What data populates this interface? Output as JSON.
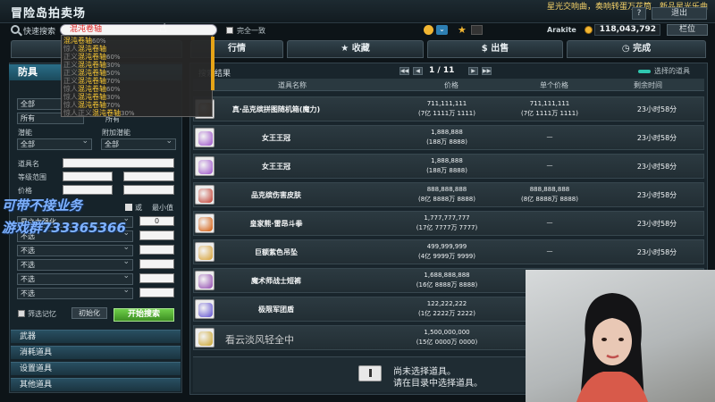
{
  "window": {
    "title": "冒险岛拍卖场",
    "marquee": "星光交响曲，奏响转蛋万花筒，新品星光乐曲",
    "help_btn": "?",
    "exit_btn": "退出"
  },
  "search": {
    "icon": "search-icon",
    "label": "快速搜索",
    "value": "混沌卷轴",
    "exact_label": "完全一致",
    "account": "Arakite",
    "meso": "118,043,792",
    "storage_btn": "栏位"
  },
  "dropdown": {
    "items": [
      {
        "prefix": "",
        "highlight": "混沌卷轴",
        "pct": "60%",
        "style": "yellow"
      },
      {
        "prefix": "惊人",
        "highlight": "混沌卷轴",
        "pct": "",
        "style": "gray"
      },
      {
        "prefix": "正义",
        "highlight": "混沌卷轴",
        "pct": "60%",
        "style": "gray"
      },
      {
        "prefix": "正义",
        "highlight": "混沌卷轴",
        "pct": "30%",
        "style": "gray"
      },
      {
        "prefix": "正义",
        "highlight": "混沌卷轴",
        "pct": "50%",
        "style": "gray"
      },
      {
        "prefix": "正义",
        "highlight": "混沌卷轴",
        "pct": "70%",
        "style": "gray"
      },
      {
        "prefix": "惊人",
        "highlight": "混沌卷轴",
        "pct": "60%",
        "style": "gray"
      },
      {
        "prefix": "惊人",
        "highlight": "混沌卷轴",
        "pct": "30%",
        "style": "gray"
      },
      {
        "prefix": "惊人",
        "highlight": "混沌卷轴",
        "pct": "70%",
        "style": "gray"
      },
      {
        "prefix": "惊人正义",
        "highlight": "混沌卷轴",
        "pct": "30%",
        "style": "gray"
      }
    ]
  },
  "tabs": [
    "行情",
    "收藏",
    "出售",
    "完成"
  ],
  "filters": {
    "category": "防具",
    "all1": "全部",
    "all2": "所有",
    "all3": "所有",
    "potential_label": "潜能",
    "add_potential_label": "附加潜能",
    "potential_value": "全部",
    "add_potential_value": "全部",
    "item_name_label": "道具名",
    "level_label": "等级范围",
    "price_label": "价格",
    "or_label": "或",
    "min_label": "最小值",
    "stat_placeholder": "星之力强化",
    "min_value": "0",
    "none": "不选",
    "remember_label": "筛选记忆",
    "reset_btn": "初始化",
    "search_btn": "开始搜索"
  },
  "categories": [
    "武器",
    "消耗道具",
    "设置道具",
    "其他道具"
  ],
  "results": {
    "title": "搜索结果",
    "page": "1 / 11",
    "selected_label": "选择的道具",
    "headers": [
      "道具名称",
      "价格",
      "单个价格",
      "剩余时间"
    ],
    "rows": [
      {
        "name": "真·品克缤拼图随机箱(魔力)",
        "price": "711,111,111",
        "price_cn": "(7亿 1111万 1111)",
        "unit": "711,111,111",
        "unit_cn": "(7亿 1111万 1111)",
        "time": "23小时58分",
        "icon": "box-icon",
        "color": "#b06a2e"
      },
      {
        "name": "女王王冠",
        "price": "1,888,888",
        "price_cn": "(188万 8888)",
        "unit": "—",
        "unit_cn": "",
        "time": "23小时58分",
        "icon": "crown-icon",
        "color": "#9b4fc9"
      },
      {
        "name": "女王王冠",
        "price": "1,888,888",
        "price_cn": "(188万 8888)",
        "unit": "—",
        "unit_cn": "",
        "time": "23小时58分",
        "icon": "crown-icon",
        "color": "#9b4fc9"
      },
      {
        "name": "品克缤伤害皮肤",
        "price": "888,888,888",
        "price_cn": "(8亿 8888万 8888)",
        "unit": "888,888,888",
        "unit_cn": "(8亿 8888万 8888)",
        "time": "23小时58分",
        "icon": "slot-icon",
        "color": "#c0392b"
      },
      {
        "name": "皇家熊·雷昂斗拳",
        "price": "1,777,777,777",
        "price_cn": "(17亿 7777万 7777)",
        "unit": "—",
        "unit_cn": "",
        "time": "23小时58分",
        "icon": "ring-icon",
        "color": "#d35400"
      },
      {
        "name": "巨额紫色吊坠",
        "price": "499,999,999",
        "price_cn": "(4亿 9999万 9999)",
        "unit": "—",
        "unit_cn": "",
        "time": "23小时58分",
        "icon": "pendant-icon",
        "color": "#d69e2e"
      },
      {
        "name": "魔术师战士短裤",
        "price": "1,688,888,888",
        "price_cn": "(16亿 8888万 8888)",
        "unit": "—",
        "unit_cn": "",
        "time": "23小时58分",
        "icon": "pants-icon",
        "color": "#8e44ad"
      },
      {
        "name": "极限军团盾",
        "price": "122,222,222",
        "price_cn": "(1亿 2222万 2222)",
        "unit": "—",
        "unit_cn": "",
        "time": "23小时58分",
        "icon": "shield-icon",
        "color": "#5b4ccf"
      },
      {
        "name": "",
        "price": "1,500,000,000",
        "price_cn": "(15亿 0000万 0000)",
        "unit": "",
        "unit_cn": "",
        "time": "",
        "icon": "crown-icon",
        "color": "#c9a227"
      }
    ],
    "empty_line1": "尚未选择道具。",
    "empty_line2": "请在目录中选择道具。"
  },
  "overlay": {
    "promo1": "可带不接业务",
    "promo2": "游戏群733365366",
    "watermark": "看云淡风轻全中"
  }
}
